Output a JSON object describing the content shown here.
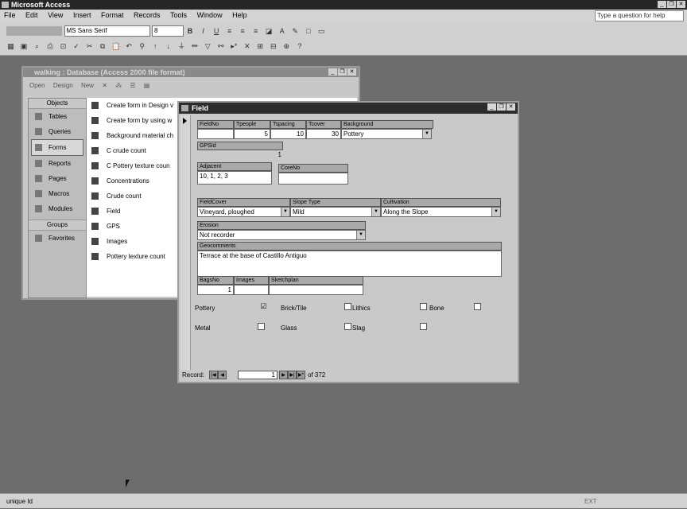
{
  "app": {
    "title": "Microsoft Access",
    "ask_placeholder": "Type a question for help"
  },
  "menu": [
    "File",
    "Edit",
    "View",
    "Insert",
    "Format",
    "Records",
    "Tools",
    "Window",
    "Help"
  ],
  "formatting": {
    "font": "MS Sans Serif",
    "size": "8",
    "bold": "B",
    "italic": "I",
    "underline": "U"
  },
  "database_window": {
    "title": "walking : Database (Access 2000 file format)",
    "toolbar": [
      "Open",
      "Design",
      "New"
    ],
    "objects_header": "Objects",
    "objects": [
      "Tables",
      "Queries",
      "Forms",
      "Reports",
      "Pages",
      "Macros",
      "Modules"
    ],
    "selected_object": "Forms",
    "groups_header": "Groups",
    "groups": [
      "Favorites"
    ],
    "items": [
      "Create form in Design v",
      "Create form by using w",
      "Background material ch",
      "C crude count",
      "C Pottery texture coun",
      "Concentrations",
      "Crude count",
      "Field",
      "GPS",
      "Images",
      "Pottery texture count"
    ]
  },
  "form": {
    "title": "Field",
    "fields": {
      "FieldNo": {
        "label": "FieldNo",
        "value": ""
      },
      "Tpeople": {
        "label": "Tpeople",
        "value": "5"
      },
      "Tspacing": {
        "label": "Tspacing",
        "value": "10"
      },
      "Tcover": {
        "label": "Tcover",
        "value": "30"
      },
      "Background": {
        "label": "Background",
        "value": "Pottery"
      },
      "GPSId": {
        "label": "GPSId",
        "value": "1"
      },
      "Adjacent": {
        "label": "Adjacent",
        "value": "10, 1, 2, 3"
      },
      "CoreNo": {
        "label": "CoreNo",
        "value": ""
      },
      "FieldCover": {
        "label": "FieldCover",
        "value": "Vineyard, ploughed"
      },
      "SlopeType": {
        "label": "Slope Type",
        "value": "Mild"
      },
      "Cultivation": {
        "label": "Cultivation",
        "value": "Along the Slope"
      },
      "Erosion": {
        "label": "Erosion",
        "value": "Not recorder"
      },
      "Geocomments": {
        "label": "Geocomments",
        "value": "Terrace at the base of Castillo Antiguo"
      },
      "BagsNo": {
        "label": "BagsNo",
        "value": "1"
      },
      "Images": {
        "label": "Images",
        "value": ""
      },
      "Sketchplan": {
        "label": "Sketchplan",
        "value": ""
      }
    },
    "checks": [
      {
        "label": "Pottery",
        "checked": true
      },
      {
        "label": "Brick/Tile",
        "checked": false
      },
      {
        "label": "Lithics",
        "checked": false
      },
      {
        "label": "Bone",
        "checked": false
      },
      {
        "label": "Metal",
        "checked": false
      },
      {
        "label": "Glass",
        "checked": false
      },
      {
        "label": "Slag",
        "checked": false
      }
    ],
    "nav": {
      "label": "Record:",
      "current": "1",
      "of_text": "of 372"
    }
  },
  "status": {
    "left": "unique Id",
    "ext": "EXT"
  }
}
